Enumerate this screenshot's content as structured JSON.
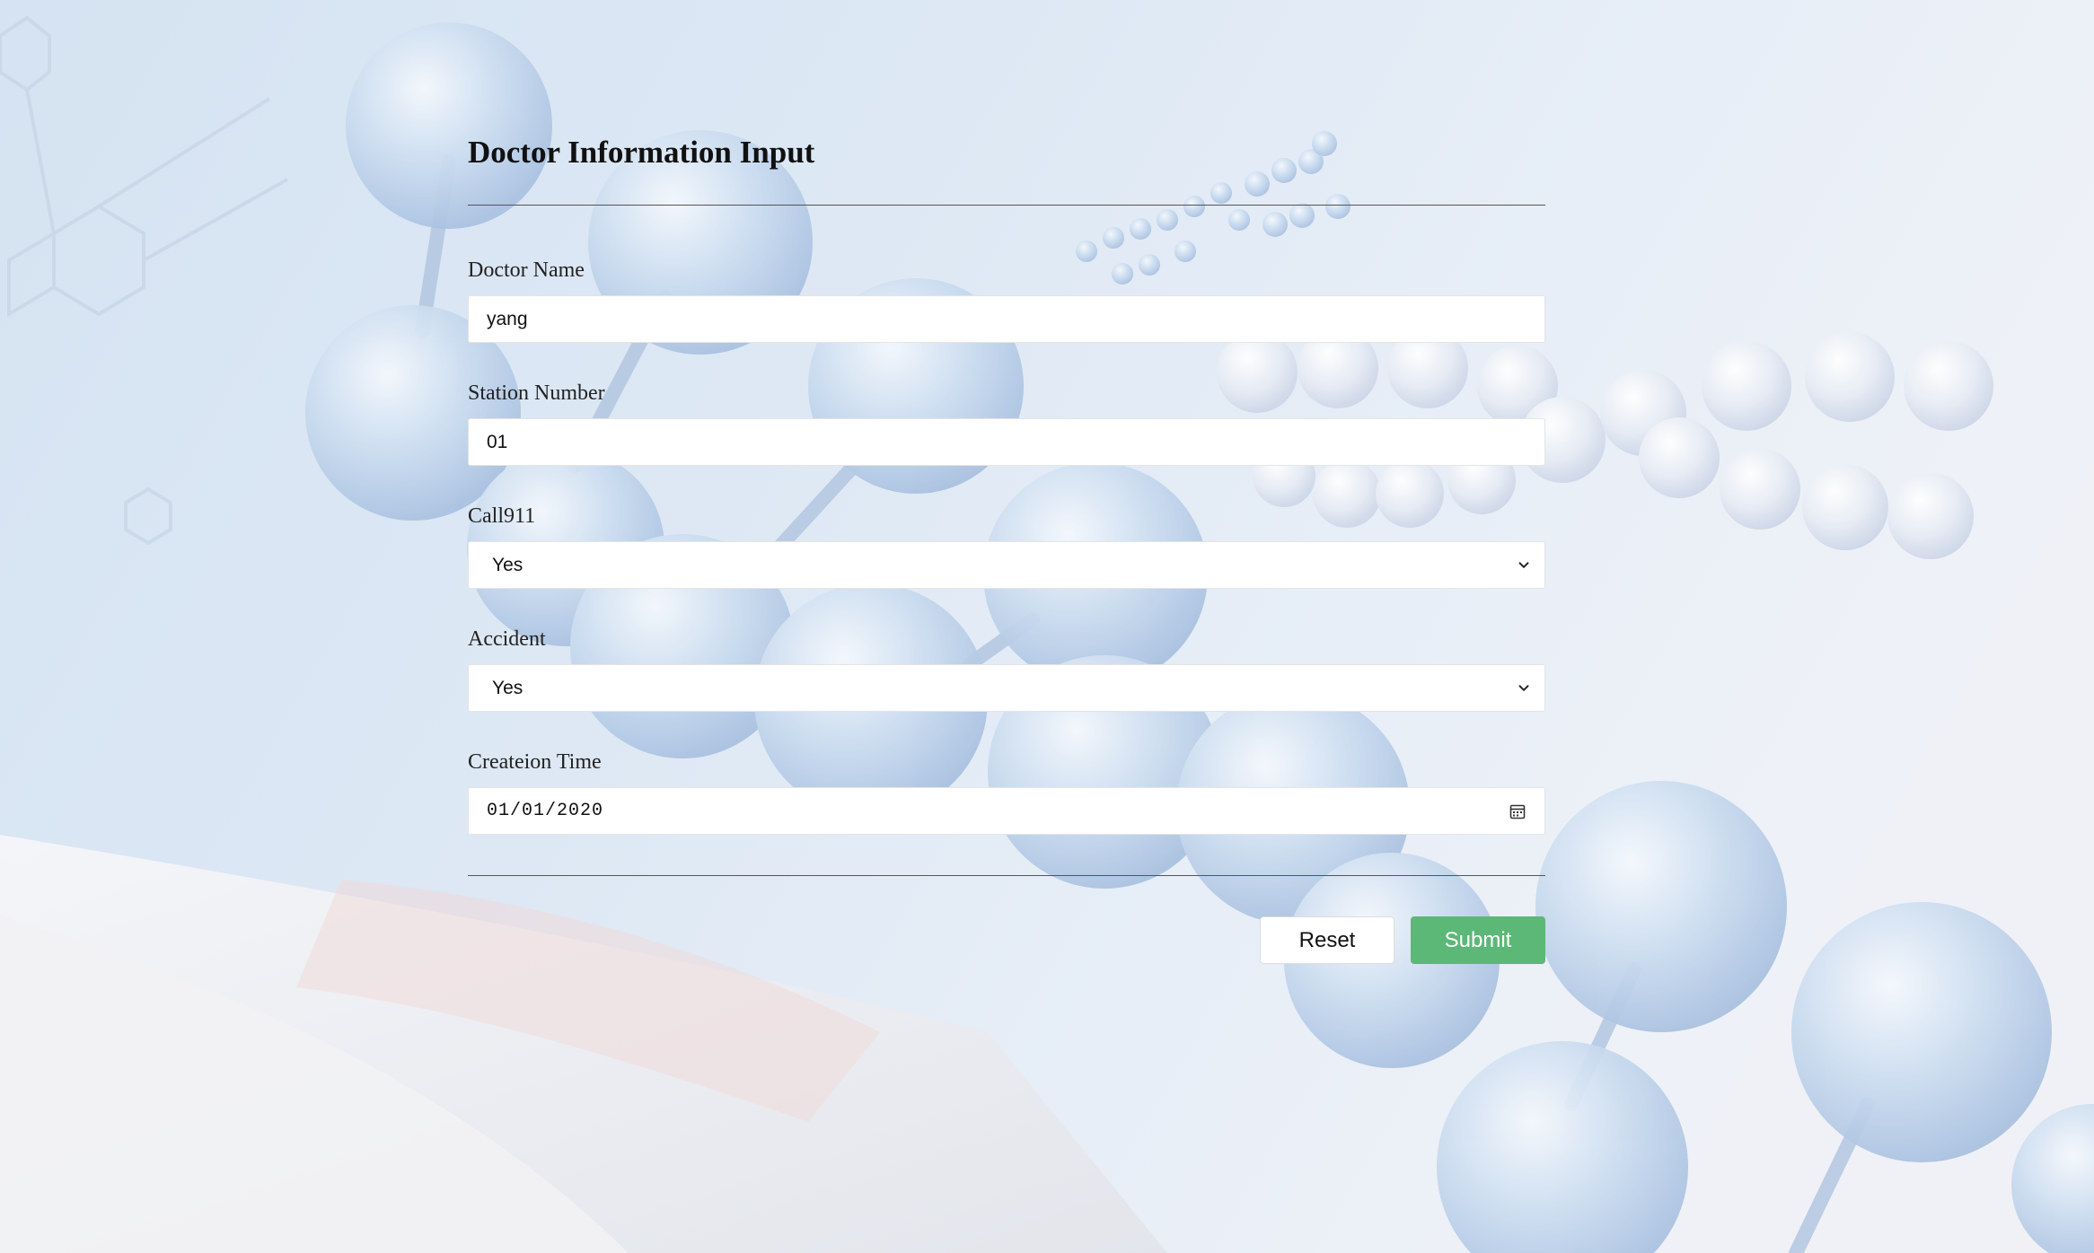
{
  "form": {
    "title": "Doctor Information Input",
    "fields": {
      "doctor_name": {
        "label": "Doctor Name",
        "value": "yang"
      },
      "station_number": {
        "label": "Station Number",
        "value": "01"
      },
      "call911": {
        "label": "Call911",
        "value": "Yes"
      },
      "accident": {
        "label": "Accident",
        "value": "Yes"
      },
      "creation_time": {
        "label": "Createion Time",
        "value": "01/01/2020"
      }
    },
    "buttons": {
      "reset": "Reset",
      "submit": "Submit"
    }
  },
  "icons": {
    "select_arrow": "chevron-down-icon",
    "date_picker": "calendar-icon"
  },
  "colors": {
    "submit_bg": "#5cb876",
    "background": "#dde8f4"
  }
}
